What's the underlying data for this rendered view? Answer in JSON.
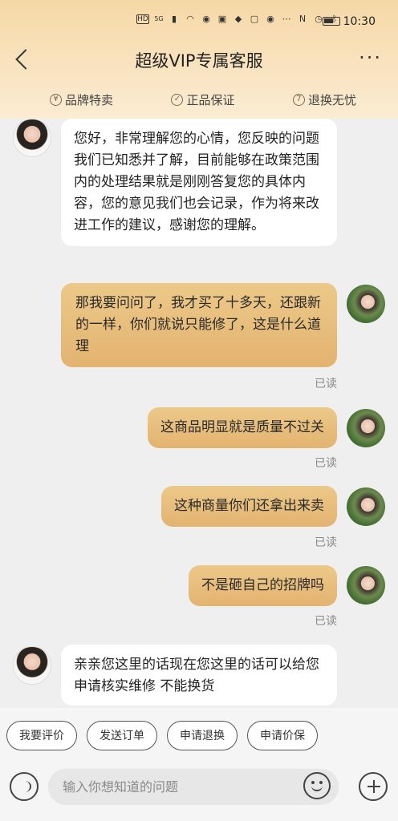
{
  "status_bar": {
    "time": "10:30",
    "network_badge": "HD",
    "signal_label": "5G",
    "icons": [
      "signal-icon",
      "wifi-icon",
      "weibo-icon",
      "app-icon",
      "app-icon",
      "app-icon",
      "weibo-icon",
      "more-dots-icon",
      "nfc-icon",
      "alarm-icon",
      "bluetooth-icon",
      "battery-icon"
    ]
  },
  "header": {
    "title": "超级VIP专属客服",
    "more_label": "···"
  },
  "features": [
    {
      "label": "品牌特卖",
      "icon": "tag-icon"
    },
    {
      "label": "正品保证",
      "icon": "check-badge-icon"
    },
    {
      "label": "退换无忧",
      "icon": "seven-day-icon"
    }
  ],
  "messages": [
    {
      "from": "agent",
      "text": "您好，非常理解您的心情，您反映的问题我们已知悉并了解，目前能够在政策范围内的处理结果就是刚刚答复您的具体内容，您的意见我们也会记录，作为将来改进工作的建议，感谢您的理解。"
    },
    {
      "from": "user",
      "text": "那我要问问了，我才买了十多天，还跟新的一样，你们就说只能修了，这是什么道理",
      "status": "已读"
    },
    {
      "from": "user",
      "text": "这商品明显就是质量不过关",
      "status": "已读"
    },
    {
      "from": "user",
      "text": "这种商量你们还拿出来卖",
      "status": "已读"
    },
    {
      "from": "user",
      "text": "不是砸自己的招牌吗",
      "status": "已读"
    },
    {
      "from": "agent",
      "text": "亲亲您这里的话现在您这里的话可以给您申请核实维修 不能换货"
    }
  ],
  "quick_actions": [
    "我要评价",
    "发送订单",
    "申请退换",
    "申请价保"
  ],
  "input": {
    "placeholder": "输入你想知道的问题",
    "value": ""
  },
  "colors": {
    "header_gradient_top": "#f6d8a6",
    "user_bubble": "#e8bd7c",
    "agent_bubble": "#ffffff",
    "chat_background": "#efefef"
  }
}
